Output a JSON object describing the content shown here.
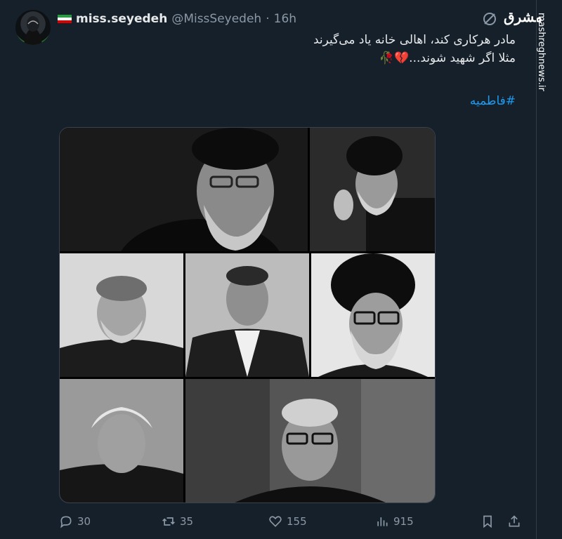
{
  "tweet": {
    "display_name": "miss.seyedeh",
    "handle": "@MissSeyedeh",
    "separator": "·",
    "time": "16h",
    "lines": [
      "مادر هرکاری کند، اهالی خانه یاد می‌گیرند",
      "مثلا اگر شهید شوند..."
    ],
    "emoji": "💔🥀",
    "hashtag": "#فاطمیه"
  },
  "watermark": {
    "logo_text": "مشرق",
    "side_text": "mashreghnews.ir"
  },
  "icons": {
    "flag": "iran-flag-icon",
    "grok": "grok-icon",
    "reply": "reply-icon",
    "retweet": "retweet-icon",
    "like": "heart-icon",
    "views": "views-icon",
    "bookmark": "bookmark-icon",
    "share": "share-icon"
  },
  "actions": {
    "replies": "30",
    "retweets": "35",
    "likes": "155",
    "views": "915"
  },
  "colors": {
    "background": "#15202b",
    "text": "#e7e9ea",
    "muted": "#8b98a5",
    "link": "#1d9bf0",
    "flag_green": "#239f40",
    "flag_red": "#da0000"
  }
}
